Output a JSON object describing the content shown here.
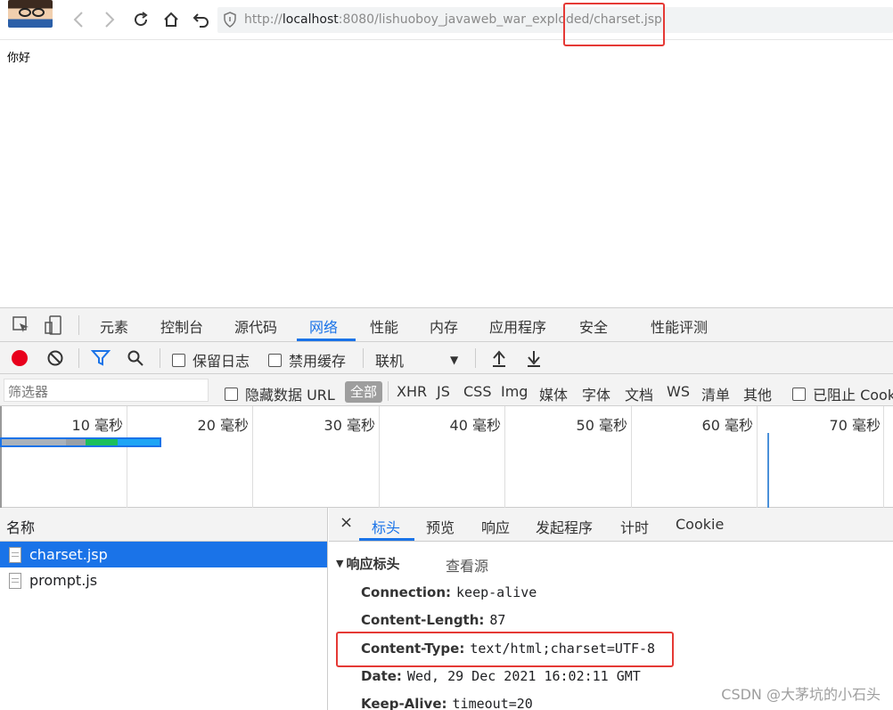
{
  "browser": {
    "url_prefix": "http://",
    "url_host": "localhost",
    "url_rest": ":8080/lishuoboy_javaweb_war_exploded/charset.jsp"
  },
  "page": {
    "body_text": "你好"
  },
  "devtools": {
    "tabs": [
      "元素",
      "控制台",
      "源代码",
      "网络",
      "性能",
      "内存",
      "应用程序",
      "安全",
      "性能评测"
    ],
    "active_tab": "网络",
    "network_bar": {
      "preserve_log": "保留日志",
      "disable_cache": "禁用缓存",
      "throttle": "联机"
    },
    "filter_bar": {
      "placeholder": "筛选器",
      "hide_data_url": "隐藏数据 URL",
      "all": "全部",
      "types": [
        "XHR",
        "JS",
        "CSS",
        "Img",
        "媒体",
        "字体",
        "文档",
        "WS",
        "清单",
        "其他"
      ],
      "blocked": "已阻止 Cook"
    },
    "timeline": {
      "ticks": [
        "10 毫秒",
        "20 毫秒",
        "30 毫秒",
        "40 毫秒",
        "50 毫秒",
        "60 毫秒",
        "70 毫秒"
      ]
    },
    "requests": {
      "header": "名称",
      "items": [
        {
          "name": "charset.jsp",
          "selected": true
        },
        {
          "name": "prompt.js",
          "selected": false
        }
      ]
    },
    "detail": {
      "close": "×",
      "tabs": [
        "标头",
        "预览",
        "响应",
        "发起程序",
        "计时",
        "Cookie"
      ],
      "active_tab": "标头",
      "section_title": "响应标头",
      "view_source": "查看源",
      "headers": [
        {
          "key": "Connection:",
          "value": "keep-alive"
        },
        {
          "key": "Content-Length:",
          "value": "87"
        },
        {
          "key": "Content-Type:",
          "value": "text/html;charset=UTF-8"
        },
        {
          "key": "Date:",
          "value": "Wed, 29 Dec 2021 16:02:11 GMT"
        },
        {
          "key": "Keep-Alive:",
          "value": "timeout=20"
        }
      ]
    }
  },
  "watermark": "CSDN @大茅坑的小石头",
  "colors": {
    "accent": "#1a73e8",
    "highlight": "#e53935",
    "record": "#e8001c"
  }
}
